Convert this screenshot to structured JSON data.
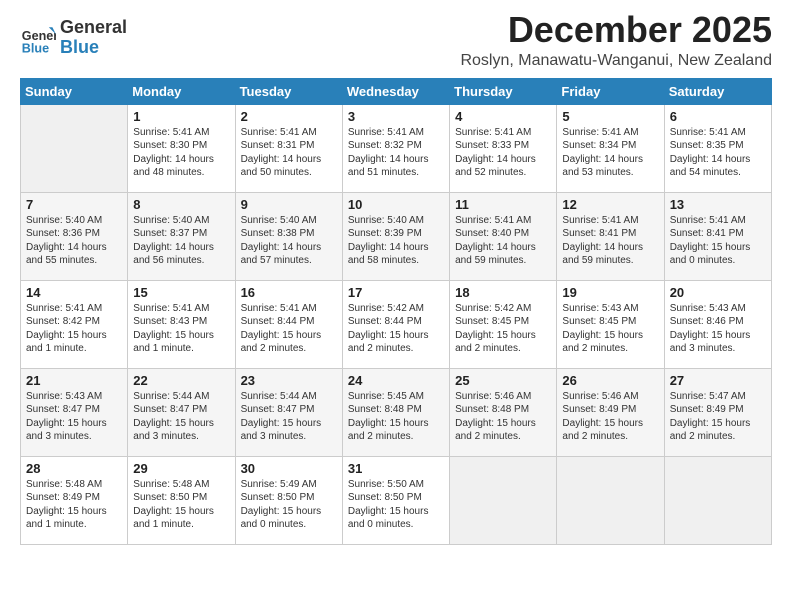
{
  "header": {
    "logo_line1": "General",
    "logo_line2": "Blue",
    "month": "December 2025",
    "location": "Roslyn, Manawatu-Wanganui, New Zealand"
  },
  "weekdays": [
    "Sunday",
    "Monday",
    "Tuesday",
    "Wednesday",
    "Thursday",
    "Friday",
    "Saturday"
  ],
  "weeks": [
    [
      {
        "day": "",
        "info": ""
      },
      {
        "day": "1",
        "info": "Sunrise: 5:41 AM\nSunset: 8:30 PM\nDaylight: 14 hours\nand 48 minutes."
      },
      {
        "day": "2",
        "info": "Sunrise: 5:41 AM\nSunset: 8:31 PM\nDaylight: 14 hours\nand 50 minutes."
      },
      {
        "day": "3",
        "info": "Sunrise: 5:41 AM\nSunset: 8:32 PM\nDaylight: 14 hours\nand 51 minutes."
      },
      {
        "day": "4",
        "info": "Sunrise: 5:41 AM\nSunset: 8:33 PM\nDaylight: 14 hours\nand 52 minutes."
      },
      {
        "day": "5",
        "info": "Sunrise: 5:41 AM\nSunset: 8:34 PM\nDaylight: 14 hours\nand 53 minutes."
      },
      {
        "day": "6",
        "info": "Sunrise: 5:41 AM\nSunset: 8:35 PM\nDaylight: 14 hours\nand 54 minutes."
      }
    ],
    [
      {
        "day": "7",
        "info": "Sunrise: 5:40 AM\nSunset: 8:36 PM\nDaylight: 14 hours\nand 55 minutes."
      },
      {
        "day": "8",
        "info": "Sunrise: 5:40 AM\nSunset: 8:37 PM\nDaylight: 14 hours\nand 56 minutes."
      },
      {
        "day": "9",
        "info": "Sunrise: 5:40 AM\nSunset: 8:38 PM\nDaylight: 14 hours\nand 57 minutes."
      },
      {
        "day": "10",
        "info": "Sunrise: 5:40 AM\nSunset: 8:39 PM\nDaylight: 14 hours\nand 58 minutes."
      },
      {
        "day": "11",
        "info": "Sunrise: 5:41 AM\nSunset: 8:40 PM\nDaylight: 14 hours\nand 59 minutes."
      },
      {
        "day": "12",
        "info": "Sunrise: 5:41 AM\nSunset: 8:41 PM\nDaylight: 14 hours\nand 59 minutes."
      },
      {
        "day": "13",
        "info": "Sunrise: 5:41 AM\nSunset: 8:41 PM\nDaylight: 15 hours\nand 0 minutes."
      }
    ],
    [
      {
        "day": "14",
        "info": "Sunrise: 5:41 AM\nSunset: 8:42 PM\nDaylight: 15 hours\nand 1 minute."
      },
      {
        "day": "15",
        "info": "Sunrise: 5:41 AM\nSunset: 8:43 PM\nDaylight: 15 hours\nand 1 minute."
      },
      {
        "day": "16",
        "info": "Sunrise: 5:41 AM\nSunset: 8:44 PM\nDaylight: 15 hours\nand 2 minutes."
      },
      {
        "day": "17",
        "info": "Sunrise: 5:42 AM\nSunset: 8:44 PM\nDaylight: 15 hours\nand 2 minutes."
      },
      {
        "day": "18",
        "info": "Sunrise: 5:42 AM\nSunset: 8:45 PM\nDaylight: 15 hours\nand 2 minutes."
      },
      {
        "day": "19",
        "info": "Sunrise: 5:43 AM\nSunset: 8:45 PM\nDaylight: 15 hours\nand 2 minutes."
      },
      {
        "day": "20",
        "info": "Sunrise: 5:43 AM\nSunset: 8:46 PM\nDaylight: 15 hours\nand 3 minutes."
      }
    ],
    [
      {
        "day": "21",
        "info": "Sunrise: 5:43 AM\nSunset: 8:47 PM\nDaylight: 15 hours\nand 3 minutes."
      },
      {
        "day": "22",
        "info": "Sunrise: 5:44 AM\nSunset: 8:47 PM\nDaylight: 15 hours\nand 3 minutes."
      },
      {
        "day": "23",
        "info": "Sunrise: 5:44 AM\nSunset: 8:47 PM\nDaylight: 15 hours\nand 3 minutes."
      },
      {
        "day": "24",
        "info": "Sunrise: 5:45 AM\nSunset: 8:48 PM\nDaylight: 15 hours\nand 2 minutes."
      },
      {
        "day": "25",
        "info": "Sunrise: 5:46 AM\nSunset: 8:48 PM\nDaylight: 15 hours\nand 2 minutes."
      },
      {
        "day": "26",
        "info": "Sunrise: 5:46 AM\nSunset: 8:49 PM\nDaylight: 15 hours\nand 2 minutes."
      },
      {
        "day": "27",
        "info": "Sunrise: 5:47 AM\nSunset: 8:49 PM\nDaylight: 15 hours\nand 2 minutes."
      }
    ],
    [
      {
        "day": "28",
        "info": "Sunrise: 5:48 AM\nSunset: 8:49 PM\nDaylight: 15 hours\nand 1 minute."
      },
      {
        "day": "29",
        "info": "Sunrise: 5:48 AM\nSunset: 8:50 PM\nDaylight: 15 hours\nand 1 minute."
      },
      {
        "day": "30",
        "info": "Sunrise: 5:49 AM\nSunset: 8:50 PM\nDaylight: 15 hours\nand 0 minutes."
      },
      {
        "day": "31",
        "info": "Sunrise: 5:50 AM\nSunset: 8:50 PM\nDaylight: 15 hours\nand 0 minutes."
      },
      {
        "day": "",
        "info": ""
      },
      {
        "day": "",
        "info": ""
      },
      {
        "day": "",
        "info": ""
      }
    ]
  ]
}
